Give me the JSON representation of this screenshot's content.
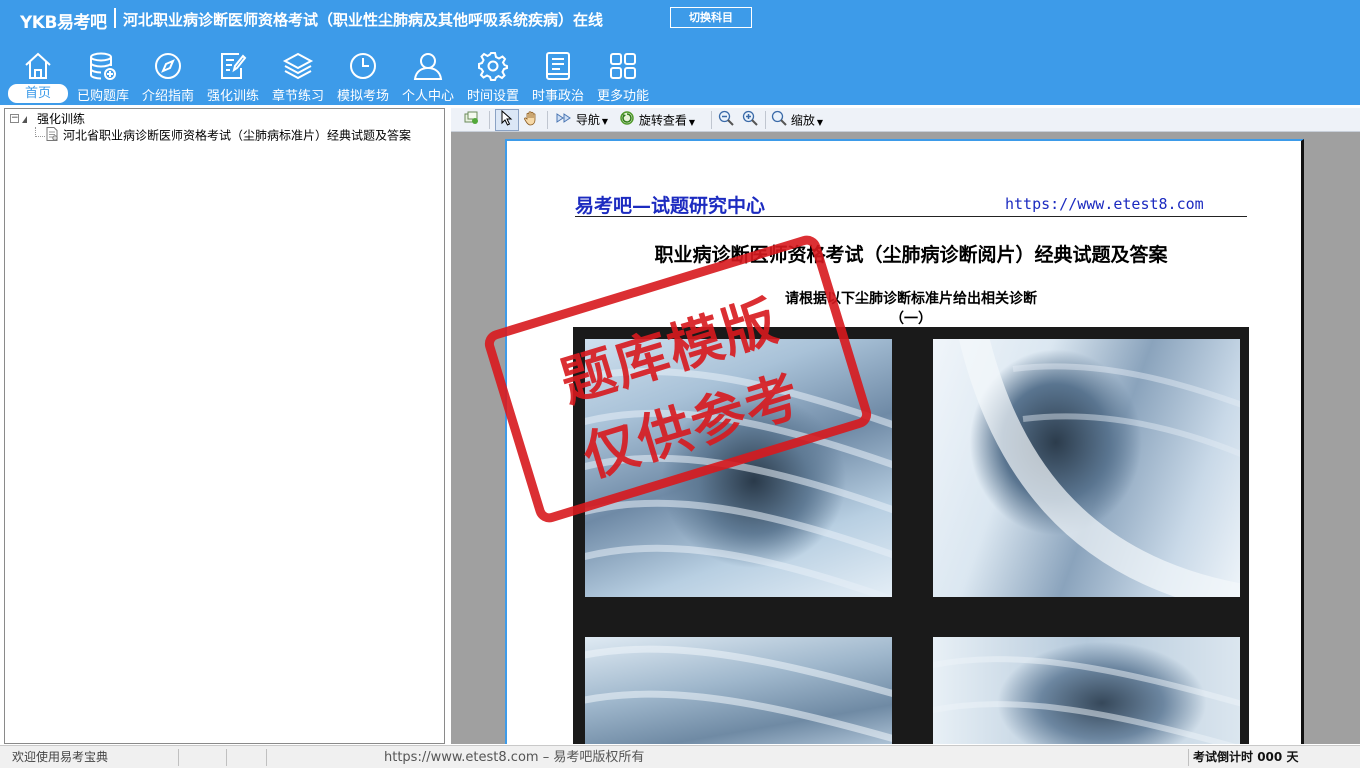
{
  "header": {
    "brand": "YKB易考吧",
    "title": "河北职业病诊断医师资格考试（职业性尘肺病及其他呼吸系统疾病）在线",
    "switch_button": "切换科目",
    "bg_color": "#3d9be9"
  },
  "nav": {
    "items": [
      {
        "label": "首页",
        "icon": "home-icon",
        "active": true
      },
      {
        "label": "已购题库",
        "icon": "database-icon"
      },
      {
        "label": "介绍指南",
        "icon": "compass-icon"
      },
      {
        "label": "强化训练",
        "icon": "edit-icon"
      },
      {
        "label": "章节练习",
        "icon": "layers-icon"
      },
      {
        "label": "模拟考场",
        "icon": "clock-icon"
      },
      {
        "label": "个人中心",
        "icon": "user-icon"
      },
      {
        "label": "时间设置",
        "icon": "gear-icon"
      },
      {
        "label": "时事政治",
        "icon": "news-icon"
      },
      {
        "label": "更多功能",
        "icon": "grid-icon"
      }
    ]
  },
  "tree": {
    "root": "强化训练",
    "child": "河北省职业病诊断医师资格考试（尘肺病标准片）经典试题及答案"
  },
  "toolbar": {
    "navigate": "导航",
    "rotate": "旋转查看",
    "zoom": "缩放"
  },
  "document": {
    "header_left": "易考吧—试题研究中心",
    "header_right": "https://www.etest8.com",
    "title": "职业病诊断医师资格考试（尘肺病诊断阅片）经典试题及答案",
    "instruction": "请根据以下尘肺诊断标准片给出相关诊断",
    "number": "（一）"
  },
  "stamp": {
    "line1": "题库模版",
    "line2": "仅供参考",
    "color": "#d8191e"
  },
  "status_bar": {
    "welcome": "欢迎使用易考宝典",
    "copyright": "https://www.etest8.com – 易考吧版权所有",
    "countdown_label": "考试倒计时",
    "countdown_value": "000",
    "countdown_unit": "天"
  }
}
